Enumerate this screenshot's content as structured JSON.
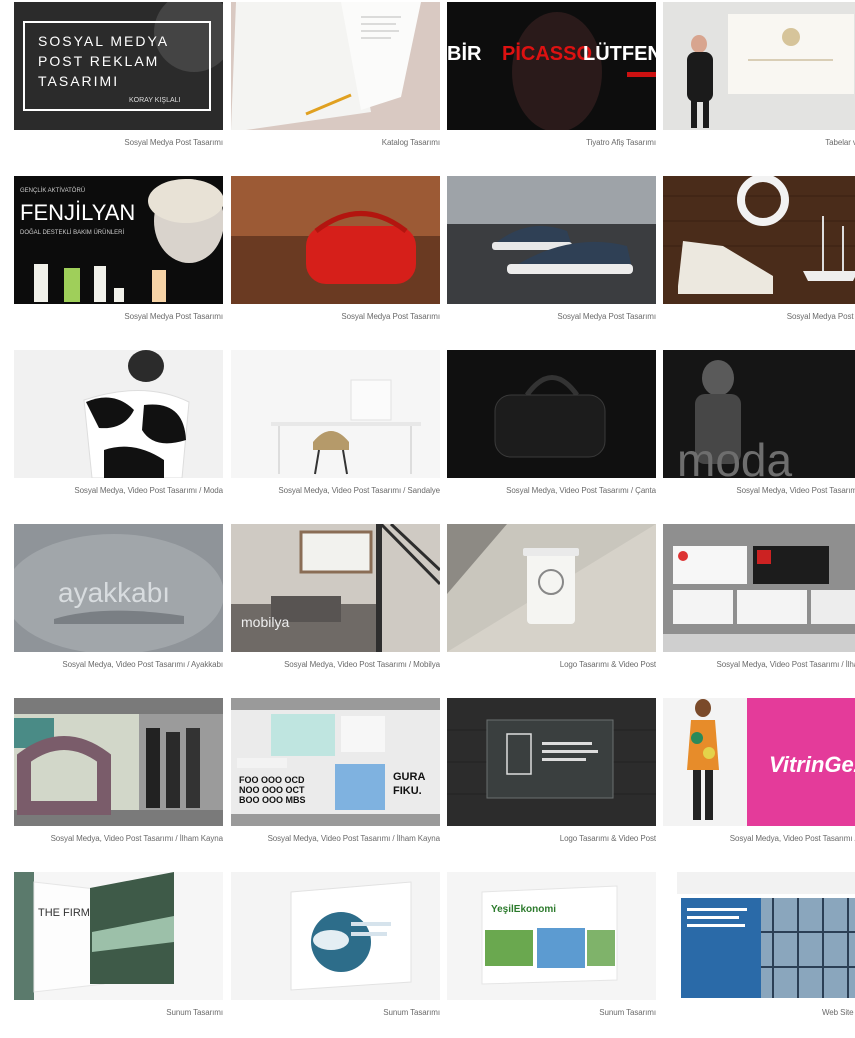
{
  "rows": [
    [
      {
        "caption": "Sosyal Medya Post Tasarımı",
        "overlay": {
          "line1": "SOSYAL MEDYA",
          "line2": "POST REKLAM",
          "line3": "TASARIMI",
          "author": "KORAY KIŞLALI"
        }
      },
      {
        "caption": "Katalog Tasarımı"
      },
      {
        "caption": "Tiyatro Afiş Tasarımı",
        "overlay": {
          "left": "BİR",
          "middle": "PİCASSO",
          "right": "LÜTFEN"
        }
      },
      {
        "caption": "Tabelar ve Lo"
      }
    ],
    [
      {
        "caption": "Sosyal Medya Post Tasarımı",
        "overlay": {
          "tag": "GENÇLİK AKTİVATÖRÜ",
          "title": "FENJİLYAN",
          "sub": "DOĞAL DESTEKLİ BAKIM ÜRÜNLERİ"
        }
      },
      {
        "caption": "Sosyal Medya Post Tasarımı"
      },
      {
        "caption": "Sosyal Medya Post Tasarımı"
      },
      {
        "caption": "Sosyal Medya Post Tasa"
      }
    ],
    [
      {
        "caption": "Sosyal Medya, Video Post Tasarımı / Moda"
      },
      {
        "caption": "Sosyal Medya, Video Post Tasarımı / Sandalye"
      },
      {
        "caption": "Sosyal Medya, Video Post Tasarımı / Çanta"
      },
      {
        "caption": "Sosyal Medya, Video Post Tasarımı / M",
        "overlay": {
          "word": "moda"
        }
      }
    ],
    [
      {
        "caption": "Sosyal Medya, Video Post Tasarımı / Ayakkabı",
        "overlay": {
          "word": "ayakkabı"
        }
      },
      {
        "caption": "Sosyal Medya, Video Post Tasarımı / Mobilya",
        "overlay": {
          "word": "mobilya"
        }
      },
      {
        "caption": "Logo Tasarımı & Video Post"
      },
      {
        "caption": "Sosyal Medya, Video Post Tasarımı / İlham K"
      }
    ],
    [
      {
        "caption": "Sosyal Medya, Video Post Tasarımı / İlham Kayna"
      },
      {
        "caption": "Sosyal Medya, Video Post Tasarımı / İlham Kayna",
        "overlay": {
          "t1": "FOO OOO OCD",
          "t2": "NOO OOO OCT",
          "t3": "BOO OOO MBS",
          "t4": "GURA",
          "t5": "FIKU."
        }
      },
      {
        "caption": "Logo Tasarımı & Video Post"
      },
      {
        "caption": "Sosyal Medya, Video Post Tasarımı / Vitri",
        "overlay": {
          "brand": "VitrinGez"
        }
      }
    ],
    [
      {
        "caption": "Sunum Tasarımı",
        "overlay": {
          "title": "THE FIRM"
        }
      },
      {
        "caption": "Sunum Tasarımı"
      },
      {
        "caption": "Sunum Tasarımı",
        "overlay": {
          "brand": "YeşilEkonomi"
        }
      },
      {
        "caption": "Web Site Tasa"
      }
    ]
  ],
  "colors": {
    "caption": "#6b6b6b",
    "background": "#ffffff"
  }
}
